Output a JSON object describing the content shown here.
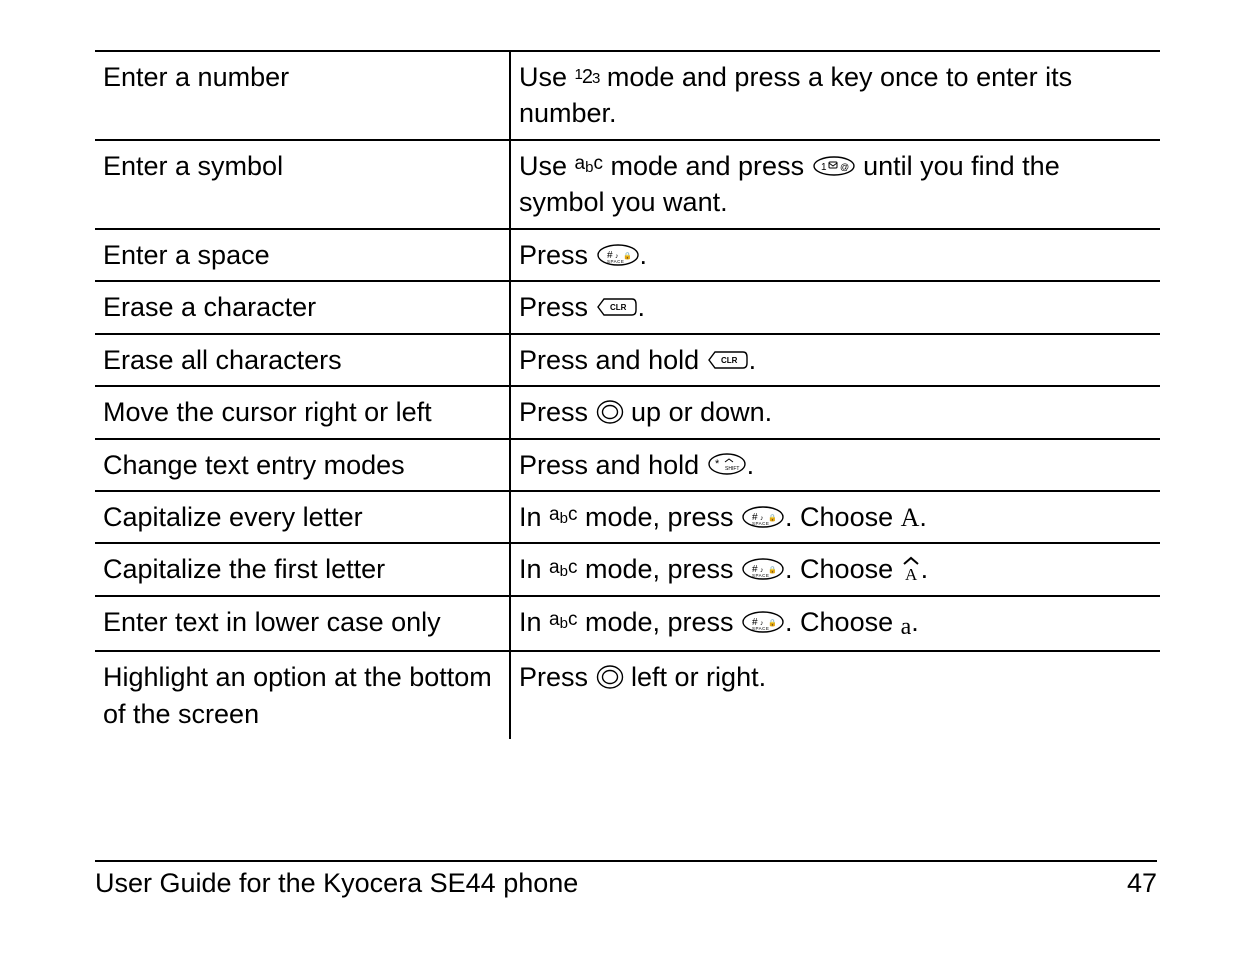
{
  "rows": [
    {
      "left": "Enter a number",
      "r_before": "Use ",
      "r_after": " mode and press a key once to enter its number.",
      "icon1": "mode-123"
    },
    {
      "left": "Enter a symbol",
      "r_before": "Use ",
      "r_mid1": " mode and press ",
      "r_after": " until you find the symbol you want.",
      "icon1": "mode-abc",
      "icon2": "key-1-sym"
    },
    {
      "left": "Enter a space",
      "r_before": "Press ",
      "r_after": ".",
      "icon1": "key-space"
    },
    {
      "left": "Erase a character",
      "r_before": "Press ",
      "r_after": ".",
      "icon1": "key-clr"
    },
    {
      "left": "Erase all characters",
      "r_before": "Press and hold ",
      "r_after": ".",
      "icon1": "key-clr"
    },
    {
      "left": "Move the cursor right or left",
      "r_before": "Press ",
      "r_after": " up or down.",
      "icon1": "nav-ring"
    },
    {
      "left": "Change text entry modes",
      "r_before": "Press and hold ",
      "r_after": ".",
      "icon1": "key-shift"
    },
    {
      "left": "Capitalize every letter",
      "r_before": "In ",
      "r_mid1": " mode, press ",
      "r_mid2": ". Choose ",
      "r_after": ".",
      "icon1": "mode-abc",
      "icon2": "key-space",
      "icon3": "choose-A"
    },
    {
      "left": "Capitalize the first letter",
      "r_before": "In ",
      "r_mid1": " mode, press ",
      "r_mid2": ". Choose ",
      "r_after": ".",
      "icon1": "mode-abc",
      "icon2": "key-space",
      "icon3": "choose-Ahat"
    },
    {
      "left": "Enter text in lower case only",
      "r_before": "In ",
      "r_mid1": " mode, press ",
      "r_mid2": ". Choose ",
      "r_after": ".",
      "icon1": "mode-abc",
      "icon2": "key-space",
      "icon3": "choose-a"
    },
    {
      "left": "Highlight an option at the bottom of the screen",
      "r_before": "Press ",
      "r_after": " left or right.",
      "icon1": "nav-ring"
    }
  ],
  "footer": {
    "title": "User Guide for the Kyocera SE44 phone",
    "page": "47"
  }
}
